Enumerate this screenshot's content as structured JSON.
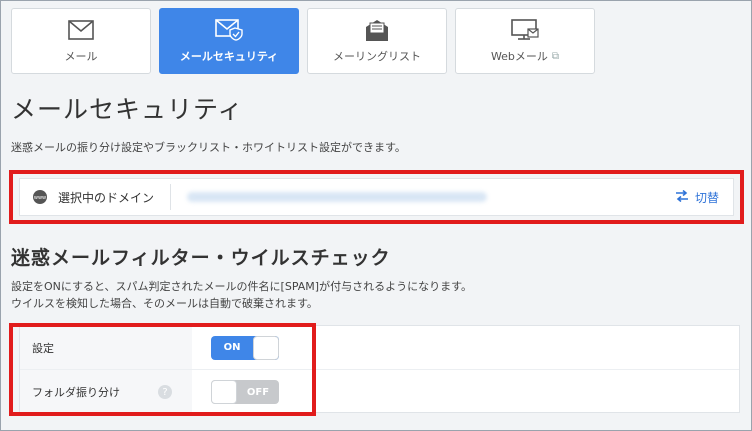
{
  "tabs": [
    {
      "label": "メール",
      "icon": "envelope-icon",
      "active": false
    },
    {
      "label": "メールセキュリティ",
      "icon": "envelope-shield-icon",
      "active": true
    },
    {
      "label": "メーリングリスト",
      "icon": "mailing-list-icon",
      "active": false
    },
    {
      "label": "Webメール",
      "icon": "webmail-monitor-icon",
      "active": false,
      "external": true
    }
  ],
  "page": {
    "title": "メールセキュリティ",
    "description": "迷惑メールの振り分け設定やブラックリスト・ホワイトリスト設定ができます。"
  },
  "domain_bar": {
    "label": "選択中のドメイン",
    "switch_label": "切替"
  },
  "filter_section": {
    "title": "迷惑メールフィルター・ウイルスチェック",
    "desc_line1": "設定をONにすると、スパム判定されたメールの件名に[SPAM]が付与されるようになります。",
    "desc_line2": "ウイルスを検知した場合、そのメールは自動で破棄されます。"
  },
  "settings": [
    {
      "label": "設定",
      "state": "ON",
      "enabled": true
    },
    {
      "label": "フォルダ振り分け",
      "state": "OFF",
      "enabled": false,
      "help": "?"
    }
  ],
  "colors": {
    "accent": "#3f86e8",
    "highlight": "#e11c1c"
  }
}
